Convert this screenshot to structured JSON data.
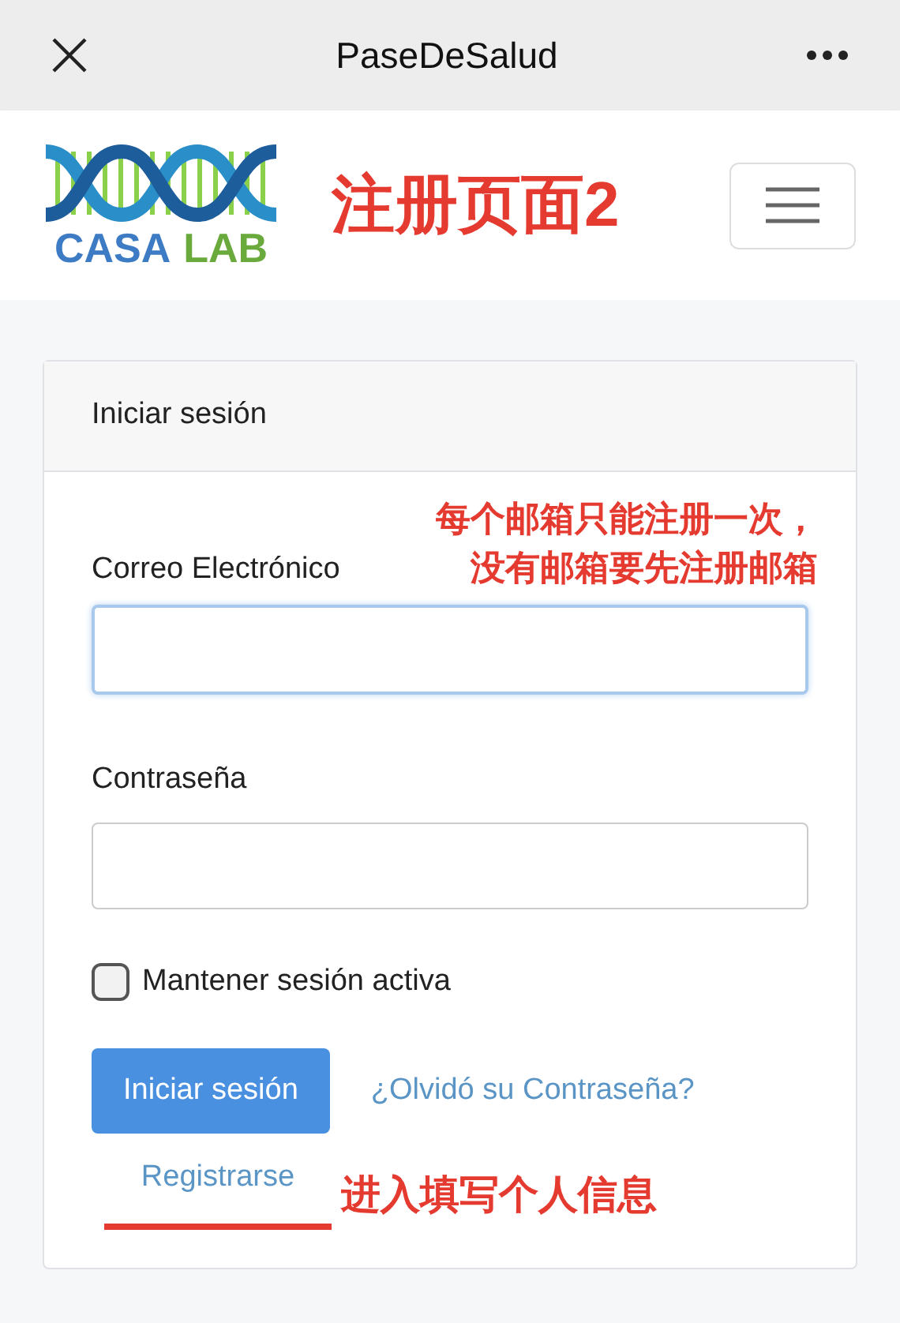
{
  "window": {
    "title": "PaseDeSalud"
  },
  "header": {
    "logo": {
      "word_1": "CASA",
      "word_2": "LAB"
    },
    "annotation": "注册页面2"
  },
  "card": {
    "title": "Iniciar sesión",
    "annotation_lines": [
      "每个邮箱只能注册一次，",
      "没有邮箱要先注册邮箱"
    ],
    "fields": [
      {
        "label": "Correo Electrónico",
        "focused": true
      },
      {
        "label": "Contraseña",
        "focused": false
      }
    ],
    "remember": {
      "label": "Mantener sesión activa",
      "checked": false
    },
    "submit": "Iniciar sesión",
    "forgot": "¿Olvidó su Contraseña?",
    "register": "Registrarse",
    "register_annotation": "进入填写个人信息"
  }
}
